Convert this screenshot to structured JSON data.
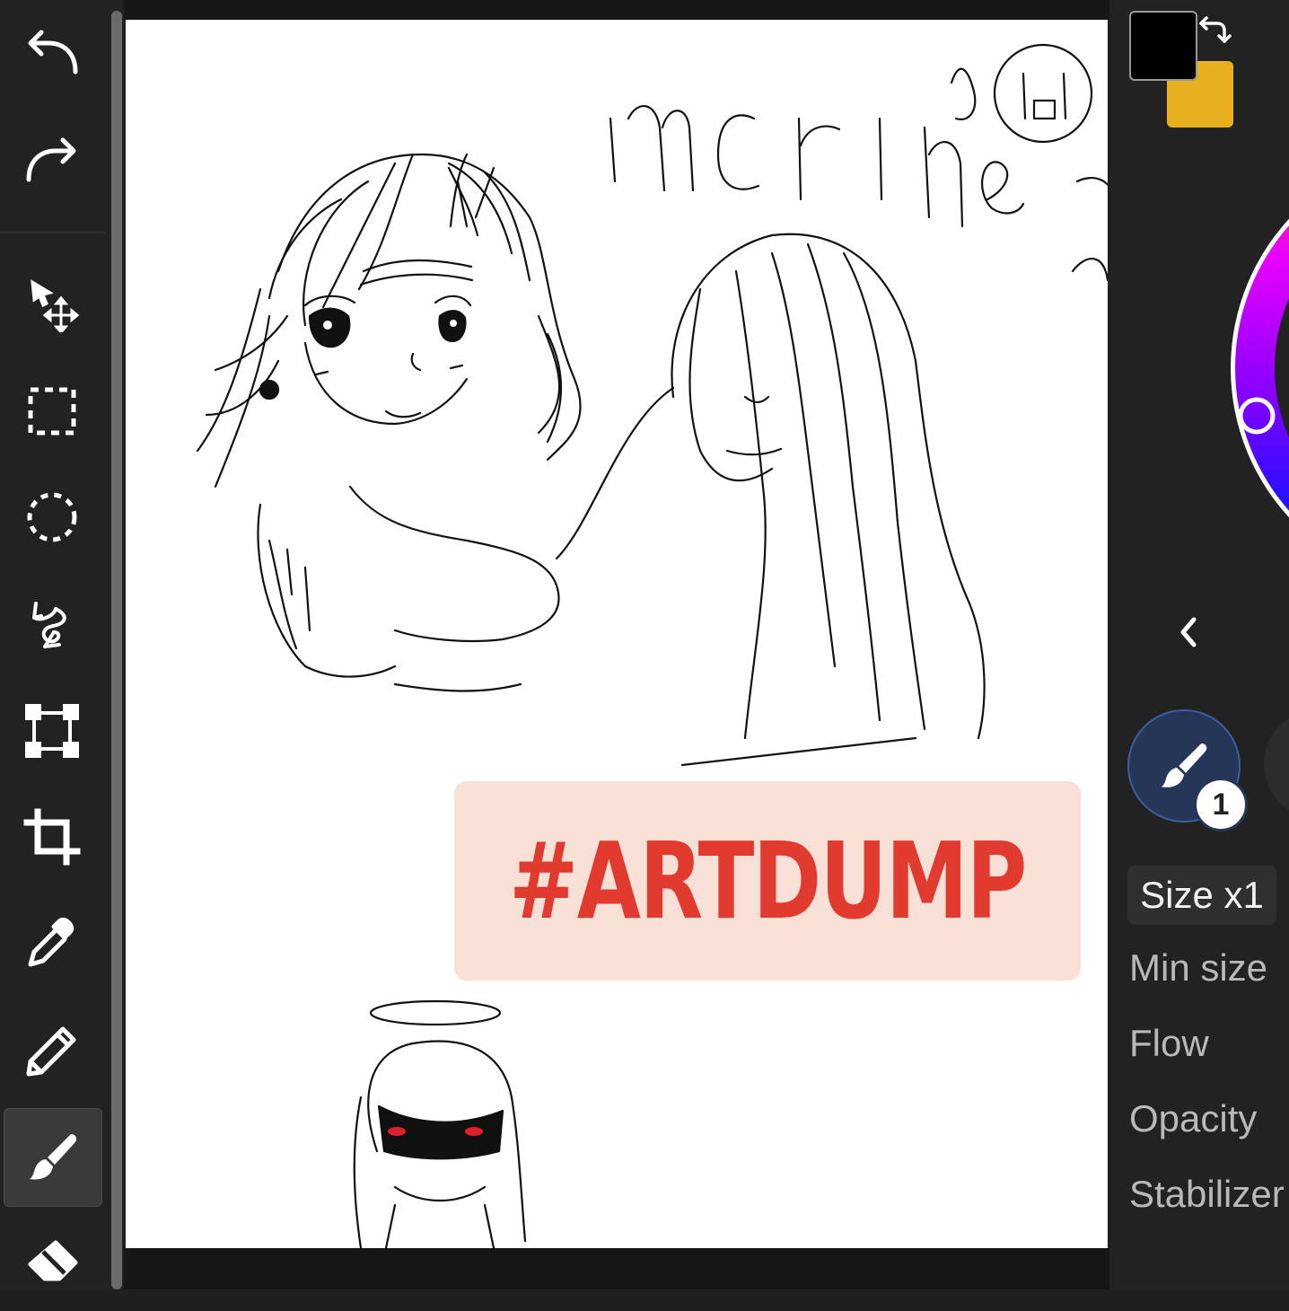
{
  "toolbar": {
    "tools": [
      {
        "name": "undo-icon"
      },
      {
        "name": "redo-icon"
      },
      {
        "name": "move-icon"
      },
      {
        "name": "rect-select-icon"
      },
      {
        "name": "ellipse-select-icon"
      },
      {
        "name": "lasso-icon"
      },
      {
        "name": "transform-icon"
      },
      {
        "name": "crop-icon"
      },
      {
        "name": "eyedropper-icon"
      },
      {
        "name": "pencil-icon"
      },
      {
        "name": "brush-icon",
        "active": true
      },
      {
        "name": "eraser-icon"
      }
    ]
  },
  "canvas": {
    "banner_text": "#ARTDUMP",
    "banner_bg": "#f8e0d7",
    "banner_color": "#e13a2e"
  },
  "panel": {
    "primary_color": "#000000",
    "secondary_color": "#e8b020",
    "brush_slot_number": "1",
    "size_label": "Size x1",
    "params": [
      "Min size",
      "Flow",
      "Opacity",
      "Stabilizer"
    ]
  }
}
